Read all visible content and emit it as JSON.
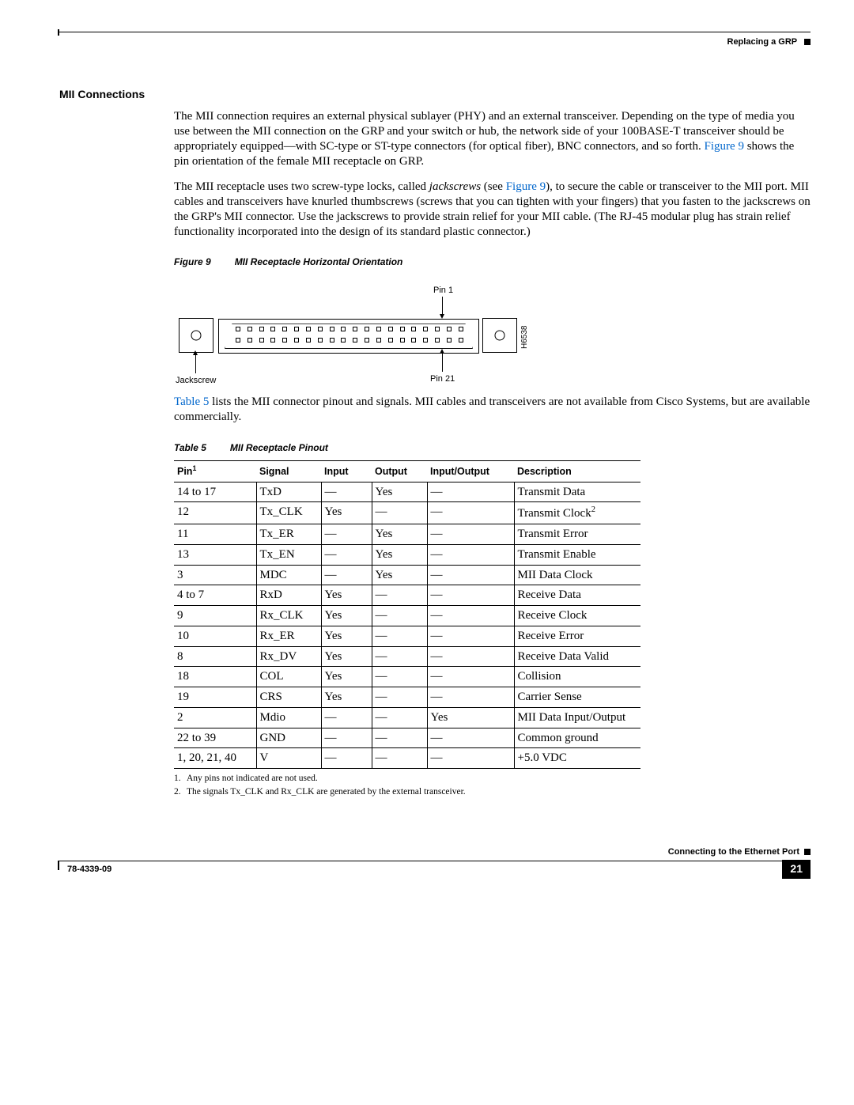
{
  "header": {
    "chapter": "Replacing a GRP"
  },
  "section_title": "MII Connections",
  "para1a": "The MII connection requires an external physical sublayer (PHY) and an external transceiver. Depending on the type of media you use between the MII connection on the GRP and your switch or hub, the network side of your 100BASE-T transceiver should be appropriately equipped—with SC-type or ST-type connectors (for optical fiber), BNC connectors, and so forth. ",
  "para1_link": "Figure 9",
  "para1b": " shows the pin orientation of the female MII receptacle on GRP.",
  "para2a": "The MII receptacle uses two screw-type locks, called ",
  "para2_em": "jackscrews",
  "para2b": " (see ",
  "para2_link": "Figure 9",
  "para2c": "), to secure the cable or transceiver to the MII port. MII cables and transceivers have knurled thumbscrews (screws that you can tighten with your fingers) that you fasten to the jackscrews on the GRP's MII connector. Use the jackscrews to provide strain relief for your MII cable. (The RJ-45 modular plug has strain relief functionality incorporated into the design of its standard plastic connector.)",
  "figure": {
    "label": "Figure 9",
    "title": "MII Receptacle Horizontal Orientation",
    "pin1": "Pin 1",
    "pin21": "Pin 21",
    "jackscrew": "Jackscrew",
    "code": "H6538"
  },
  "para3a": "",
  "para3_link": "Table 5",
  "para3b": " lists the MII connector pinout and signals. MII cables and transceivers are not available from Cisco Systems, but are available commercially.",
  "table": {
    "label": "Table 5",
    "title": "MII Receptacle Pinout",
    "headers": {
      "pin": "Pin",
      "pin_sup": "1",
      "signal": "Signal",
      "input": "Input",
      "output": "Output",
      "io": "Input/Output",
      "desc": "Description"
    },
    "rows": [
      {
        "pin": "14 to 17",
        "signal": "TxD",
        "input": "—",
        "output": "Yes",
        "io": "—",
        "desc": "Transmit Data",
        "sup": ""
      },
      {
        "pin": "12",
        "signal": "Tx_CLK",
        "input": "Yes",
        "output": "—",
        "io": "—",
        "desc": "Transmit Clock",
        "sup": "2"
      },
      {
        "pin": "11",
        "signal": "Tx_ER",
        "input": "—",
        "output": "Yes",
        "io": "—",
        "desc": "Transmit Error",
        "sup": ""
      },
      {
        "pin": "13",
        "signal": "Tx_EN",
        "input": "—",
        "output": "Yes",
        "io": "—",
        "desc": "Transmit Enable",
        "sup": ""
      },
      {
        "pin": "3",
        "signal": "MDC",
        "input": "—",
        "output": "Yes",
        "io": "—",
        "desc": "MII Data Clock",
        "sup": ""
      },
      {
        "pin": "4 to 7",
        "signal": "RxD",
        "input": "Yes",
        "output": "—",
        "io": "—",
        "desc": "Receive Data",
        "sup": ""
      },
      {
        "pin": "9",
        "signal": "Rx_CLK",
        "input": "Yes",
        "output": "—",
        "io": "—",
        "desc": "Receive Clock",
        "sup": ""
      },
      {
        "pin": "10",
        "signal": "Rx_ER",
        "input": "Yes",
        "output": "—",
        "io": "—",
        "desc": "Receive Error",
        "sup": ""
      },
      {
        "pin": "8",
        "signal": "Rx_DV",
        "input": "Yes",
        "output": "—",
        "io": "—",
        "desc": "Receive Data Valid",
        "sup": ""
      },
      {
        "pin": "18",
        "signal": "COL",
        "input": "Yes",
        "output": "—",
        "io": "—",
        "desc": "Collision",
        "sup": ""
      },
      {
        "pin": "19",
        "signal": "CRS",
        "input": "Yes",
        "output": "—",
        "io": "—",
        "desc": "Carrier Sense",
        "sup": ""
      },
      {
        "pin": "2",
        "signal": "Mdio",
        "input": "—",
        "output": "—",
        "io": "Yes",
        "desc": "MII Data Input/Output",
        "sup": ""
      },
      {
        "pin": "22 to 39",
        "signal": "GND",
        "input": "—",
        "output": "—",
        "io": "—",
        "desc": "Common ground",
        "sup": ""
      },
      {
        "pin": "1, 20, 21, 40",
        "signal": "V",
        "input": "—",
        "output": "—",
        "io": "—",
        "desc": "+5.0 VDC",
        "sup": ""
      }
    ],
    "footnote1": "Any pins not indicated are not used.",
    "footnote2": "The signals Tx_CLK and Rx_CLK are generated by the external transceiver."
  },
  "footer": {
    "right_label": "Connecting to the Ethernet Port",
    "docnum": "78-4339-09",
    "page": "21"
  }
}
